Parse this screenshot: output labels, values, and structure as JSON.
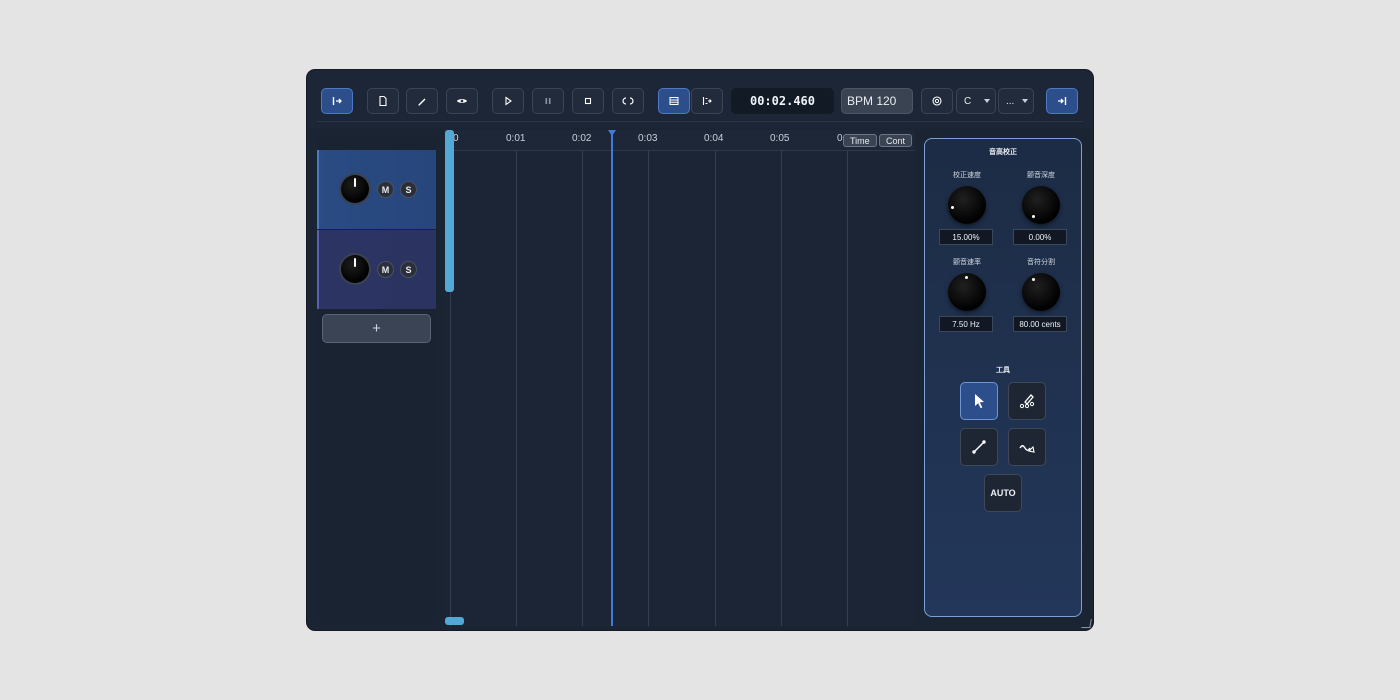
{
  "toolbar": {
    "timecode": "00:02.460",
    "bpm": "BPM 120",
    "key": "C",
    "scale": "..."
  },
  "tracks": [
    {
      "mute": "M",
      "solo": "S",
      "color": "#26467c"
    },
    {
      "mute": "M",
      "solo": "S",
      "color": "#2b3360"
    }
  ],
  "add_track_label": "+",
  "timeline": {
    "ticks": [
      "0",
      "0:01",
      "0:02",
      "0:03",
      "0:04",
      "0:05",
      "0"
    ],
    "time_button": "Time",
    "cont_button": "Cont",
    "playhead_seconds": 2.46
  },
  "panel": {
    "title": "音高校正",
    "knobs": [
      {
        "label": "校正速度",
        "value": "15.00%"
      },
      {
        "label": "颤音深度",
        "value": "0.00%"
      },
      {
        "label": "颤音速率",
        "value": "7.50 Hz"
      },
      {
        "label": "音符分割",
        "value": "80.00 cents"
      }
    ],
    "tools_title": "工具",
    "auto_label": "AUTO"
  },
  "colors": {
    "accent": "#2c4f8c",
    "playhead": "#3e7bdc",
    "scrollbar": "#53a8d4",
    "panel_border": "#7aa2d6"
  }
}
